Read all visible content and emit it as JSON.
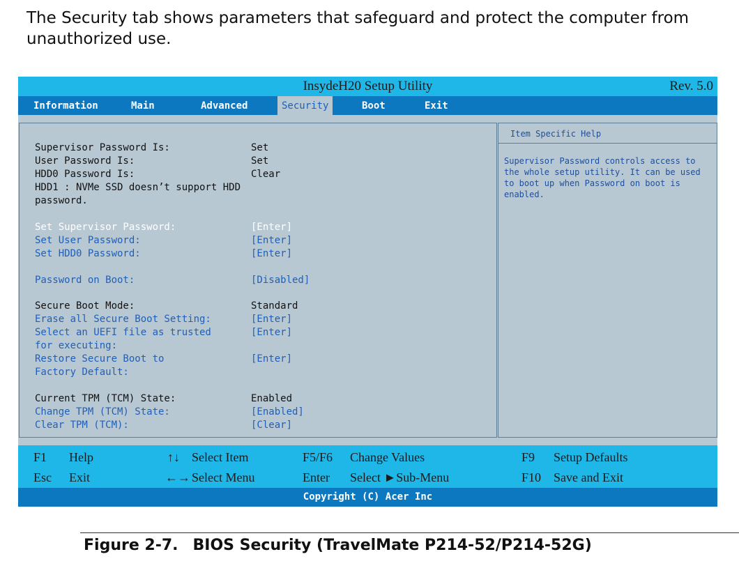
{
  "intro": "The Security tab shows parameters that safeguard and protect the computer from unauthorized use.",
  "bios": {
    "title": "InsydeH20 Setup Utility",
    "revision": "Rev. 5.0",
    "tabs": [
      "Information",
      "Main",
      "Advanced",
      "Security",
      "Boot",
      "Exit"
    ],
    "active_tab": "Security",
    "items": [
      {
        "label": "Supervisor Password Is:",
        "value": "Set"
      },
      {
        "label": "User Password Is:",
        "value": "Set"
      },
      {
        "label": "HDD0 Password Is:",
        "value": "Clear"
      },
      {
        "label": "HDD1 : NVMe SSD doesn’t support HDD",
        "value": ""
      },
      {
        "label": "password.",
        "value": ""
      },
      {
        "label": "Set Supervisor Password:",
        "value": "[Enter]"
      },
      {
        "label": "Set User Password:",
        "value": "[Enter]"
      },
      {
        "label": "Set HDD0 Password:",
        "value": "[Enter]"
      },
      {
        "label": "Password on Boot:",
        "value": "[Disabled]"
      },
      {
        "label": "Secure Boot Mode:",
        "value": "Standard"
      },
      {
        "label": "Erase all Secure Boot Setting:",
        "value": "[Enter]"
      },
      {
        "label": "Select an UEFI file as trusted",
        "value": "[Enter]"
      },
      {
        "label": "for executing:",
        "value": ""
      },
      {
        "label": "Restore Secure Boot to",
        "value": "[Enter]"
      },
      {
        "label": "Factory Default:",
        "value": ""
      },
      {
        "label": "Current TPM (TCM) State:",
        "value": "Enabled"
      },
      {
        "label": "Change TPM (TCM) State:",
        "value": "[Enabled]"
      },
      {
        "label": "Clear TPM (TCM):",
        "value": "[Clear]"
      }
    ],
    "help": {
      "title": "Item Specific Help",
      "text": "Supervisor Password controls access to the whole setup utility. It can be used to boot up when Password on boot is enabled."
    },
    "footer": {
      "keys": [
        {
          "key": "F1",
          "action": "Help"
        },
        {
          "key": "↑↓",
          "action": "Select Item"
        },
        {
          "key": "F5/F6",
          "action": "Change Values"
        },
        {
          "key": "F9",
          "action": "Setup Defaults"
        },
        {
          "key": "Esc",
          "action": "Exit"
        },
        {
          "key": "←→",
          "action": "Select Menu"
        },
        {
          "key": "Enter",
          "action": "Select ►Sub-Menu"
        },
        {
          "key": "F10",
          "action": "Save and Exit"
        }
      ]
    },
    "copyright": "Copyright (C) Acer Inc",
    "colors": {
      "title_bar": "#1fb6e8",
      "tab_bar": "#0c78c0",
      "panel_bg": "#b8c8d2",
      "link_text": "#1f5fb8",
      "selected_text": "#ffffff"
    }
  },
  "caption": {
    "number": "Figure 2-7.",
    "text": "BIOS Security (TravelMate P214-52/P214-52G)"
  }
}
